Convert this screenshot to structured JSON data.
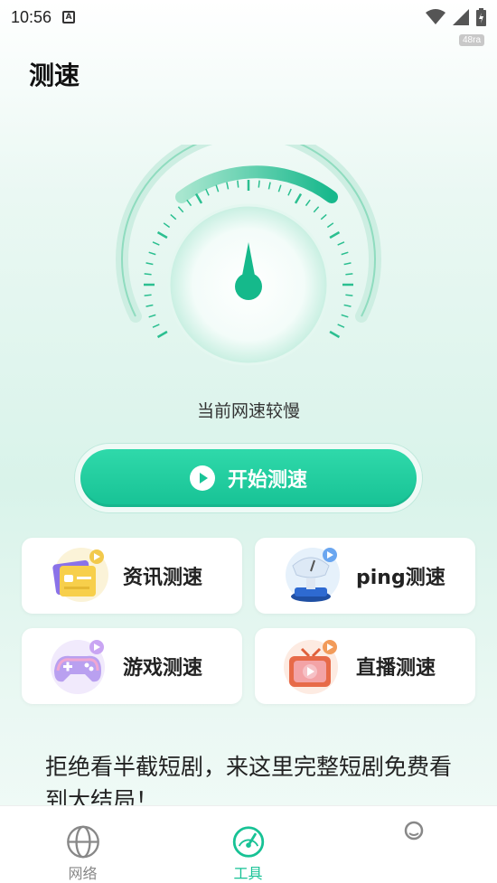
{
  "status_bar": {
    "time": "10:56",
    "notif_letter": "A",
    "badge": "48ra"
  },
  "page": {
    "title": "测速"
  },
  "speed": {
    "status": "当前网速较慢",
    "start_button": "开始测速"
  },
  "tools": [
    {
      "label": "资讯测速",
      "icon": "news-card-icon"
    },
    {
      "label": "ping测速",
      "icon": "scale-ping-icon"
    },
    {
      "label": "游戏测速",
      "icon": "gamepad-icon"
    },
    {
      "label": "直播测速",
      "icon": "tv-live-icon"
    }
  ],
  "promo": {
    "text": "拒绝看半截短剧，来这里完整短剧免费看到大结局！"
  },
  "tabbar": {
    "items": [
      {
        "label": "网络",
        "icon": "globe-icon"
      },
      {
        "label": "工具",
        "icon": "speedometer-icon",
        "active": true
      },
      {
        "label": "",
        "icon": "me-icon"
      }
    ]
  },
  "colors": {
    "accent": "#17c295",
    "text": "#222222"
  }
}
